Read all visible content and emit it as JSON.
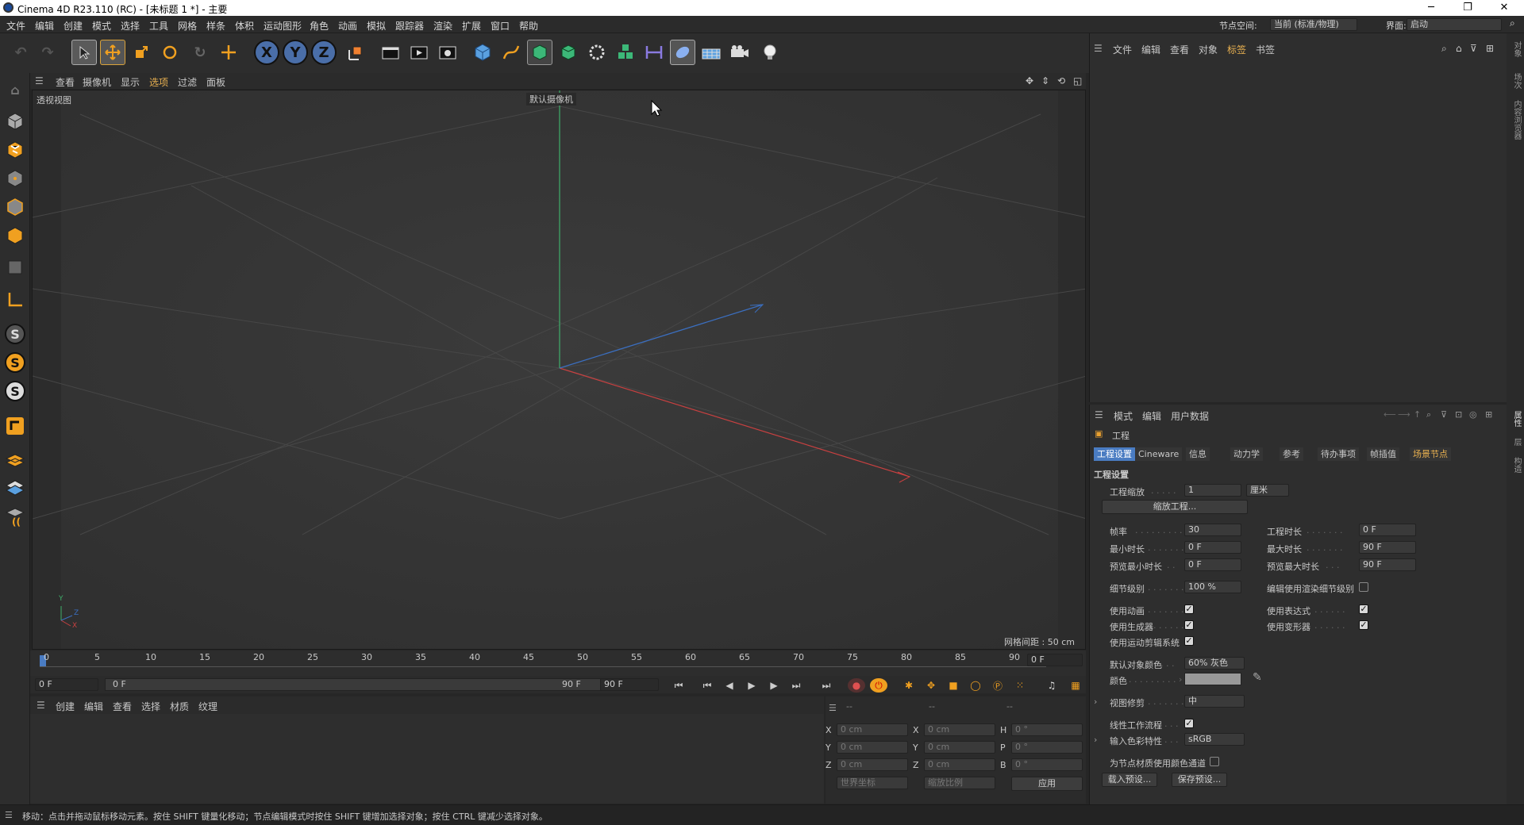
{
  "window": {
    "title": "Cinema 4D R23.110 (RC) - [未标题 1 *] - 主要",
    "minimize": "─",
    "restore": "❐",
    "close": "✕"
  },
  "menubar": {
    "items": [
      "文件",
      "编辑",
      "创建",
      "模式",
      "选择",
      "工具",
      "网格",
      "样条",
      "体积",
      "运动图形",
      "角色",
      "动画",
      "模拟",
      "跟踪器",
      "渲染",
      "扩展",
      "窗口",
      "帮助"
    ],
    "node_space_label": "节点空间:",
    "node_space_value": "当前 (标准/物理)",
    "interface_label": "界面:",
    "interface_value": "启动"
  },
  "toolbar": {
    "undo": "↶",
    "redo": "↷",
    "axis_x": "X",
    "axis_y": "Y",
    "axis_z": "Z"
  },
  "viewport": {
    "menu": [
      "查看",
      "摄像机",
      "显示",
      "选项",
      "过滤",
      "面板"
    ],
    "name": "透视视图",
    "camera": "默认摄像机",
    "grid_spacing": "网格间距 : 50 cm",
    "axis_labels": {
      "x": "X",
      "y": "Y",
      "z": "Z"
    }
  },
  "timeline": {
    "ticks": [
      "0",
      "5",
      "10",
      "15",
      "20",
      "25",
      "30",
      "35",
      "40",
      "45",
      "50",
      "55",
      "60",
      "65",
      "70",
      "75",
      "80",
      "85",
      "90"
    ],
    "current_frame_right": "0 F",
    "start_field": "0 F",
    "range_start": "0 F",
    "range_end": "90 F",
    "end_field": "90 F"
  },
  "material": {
    "menu": [
      "创建",
      "编辑",
      "查看",
      "选择",
      "材质",
      "纹理"
    ]
  },
  "coordinates": {
    "col1_header": "--",
    "col2_header": "--",
    "col3_header": "--",
    "rows": [
      {
        "a": "X",
        "av": "0 cm",
        "b": "X",
        "bv": "0 cm",
        "c": "H",
        "cv": "0 °"
      },
      {
        "a": "Y",
        "av": "0 cm",
        "b": "Y",
        "bv": "0 cm",
        "c": "P",
        "cv": "0 °"
      },
      {
        "a": "Z",
        "av": "0 cm",
        "b": "Z",
        "bv": "0 cm",
        "c": "B",
        "cv": "0 °"
      }
    ],
    "world_dropdown": "世界坐标",
    "scale_dropdown": "缩放比例",
    "apply": "应用"
  },
  "object_manager": {
    "menu": [
      "文件",
      "编辑",
      "查看",
      "对象",
      "标签",
      "书签"
    ]
  },
  "attributes": {
    "menu": [
      "模式",
      "编辑",
      "用户数据"
    ],
    "object_name": "工程",
    "tabs": [
      "工程设置",
      "Cineware",
      "信息",
      "动力学",
      "参考",
      "待办事项",
      "帧插值",
      "场景节点"
    ],
    "section": "工程设置",
    "project_scale_label": "工程缩放",
    "project_scale_value": "1",
    "project_scale_unit": "厘米",
    "scale_project_btn": "缩放工程...",
    "fps_label": "帧率",
    "fps_value": "30",
    "project_duration_label": "工程时长",
    "project_duration_value": "0 F",
    "min_time_label": "最小时长",
    "min_time_value": "0 F",
    "max_time_label": "最大时长",
    "max_time_value": "90 F",
    "preview_min_label": "预览最小时长",
    "preview_min_value": "0 F",
    "preview_max_label": "预览最大时长",
    "preview_max_value": "90 F",
    "lod_label": "细节级别",
    "lod_value": "100 %",
    "render_lod_label": "编辑使用渲染细节级别",
    "use_anim_label": "使用动画",
    "use_expr_label": "使用表达式",
    "use_gen_label": "使用生成器",
    "use_deform_label": "使用变形器",
    "use_motion_label": "使用运动剪辑系统",
    "default_color_label": "默认对象颜色",
    "default_color_value": "60% 灰色",
    "color_label": "颜色",
    "view_clip_label": "视图修剪",
    "view_clip_value": "中",
    "linear_wf_label": "线性工作流程",
    "input_color_label": "输入色彩特性",
    "input_color_value": "sRGB",
    "node_mat_label": "为节点材质使用颜色通道",
    "load_preset": "载入预设...",
    "save_preset": "保存预设..."
  },
  "status": "移动：点击并拖动鼠标移动元素。按住 SHIFT 键量化移动；节点编辑模式时按住 SHIFT 键增加选择对象；按住 CTRL 键减少选择对象。",
  "right_strip": [
    "对象",
    "场次",
    "内容浏览器",
    "属性",
    "层",
    "构造"
  ]
}
